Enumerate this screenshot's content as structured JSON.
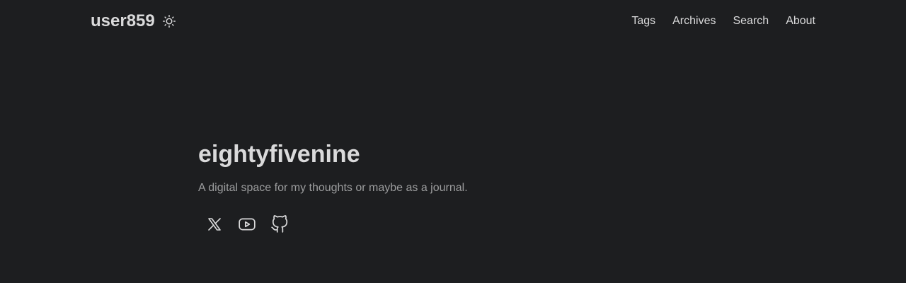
{
  "header": {
    "logo": "user859",
    "theme_toggle_icon": "sun-icon",
    "nav": [
      {
        "label": "Tags"
      },
      {
        "label": "Archives"
      },
      {
        "label": "Search"
      },
      {
        "label": "About"
      }
    ]
  },
  "hero": {
    "title": "eightyfivenine",
    "subtitle": "A digital space for my thoughts or maybe as a journal.",
    "social_icons": [
      "x-twitter-icon",
      "youtube-icon",
      "github-icon"
    ]
  },
  "colors": {
    "background": "#1d1e20",
    "primary_text": "#dadadb",
    "secondary_text": "#9b9c9d"
  }
}
